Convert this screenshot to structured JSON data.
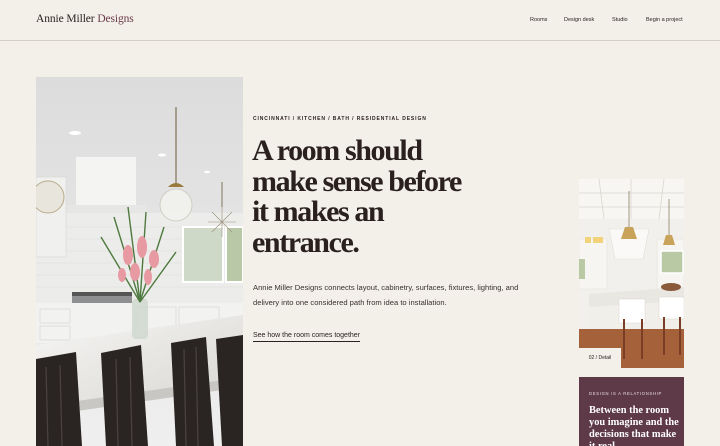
{
  "brand": {
    "name_primary": "Annie Miller",
    "name_secondary": "Designs"
  },
  "nav": {
    "items": [
      {
        "label": "Rooms"
      },
      {
        "label": "Design desk"
      },
      {
        "label": "Studio"
      },
      {
        "label": "Begin a project"
      }
    ]
  },
  "hero": {
    "eyebrow": "CINCINNATI / KITCHEN / BATH / RESIDENTIAL DESIGN",
    "headline_lines": [
      "A room should",
      "make sense before",
      "it makes an",
      "entrance."
    ],
    "lede": "Annie Miller Designs connects layout, cabinetry, surfaces, fixtures, lighting, and delivery into one considered path from idea to installation.",
    "cta": "See how the room comes together"
  },
  "detail": {
    "tag": "02 / Detail"
  },
  "card": {
    "eyebrow": "DESIGN IS A RELATIONSHIP",
    "title": "Between the room you imagine and the decisions that make it real"
  },
  "colors": {
    "background": "#f3efe9",
    "accent": "#6b3b4c",
    "card": "#5e3a48",
    "text": "#2b2320"
  },
  "icons": [
    "kitchen-photo",
    "kitchen-detail-photo"
  ]
}
